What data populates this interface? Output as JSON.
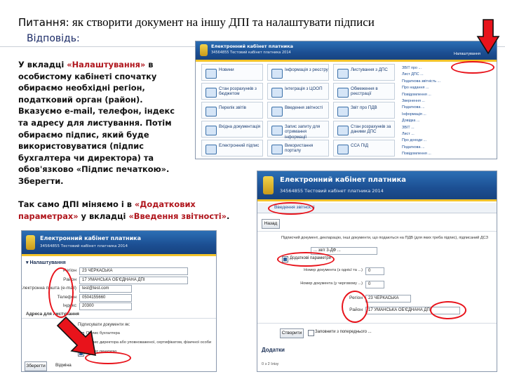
{
  "header": {
    "question_label": "Питання:",
    "question_text": " як створити документ на іншу ДПІ та налаштувати підписи",
    "answer_label": "Відповідь:"
  },
  "instructions": {
    "p1_before": "У вкладці ",
    "p1_quote": "«Налаштування»",
    "p1_after": " в особистому кабінеті спочатку обираємо необхідні регіон, податковий орган (район). Вказуємо e-mail, телефон, індекс та адресу для листування. Потім обираємо підпис, який буде використовуватися (підпис бухгалтера чи директора) та обов'язково «Підпис печаткою». Зберегти.",
    "p2_before": "Так само ДПІ міняємо і в ",
    "p2_quote1": "«Додаткових параметрах»",
    "p2_mid": " у вкладці ",
    "p2_quote2": "«Введення звітності»",
    "p2_after": "."
  },
  "shot_cabinet": {
    "banner_title": "Електронний кабінет платника",
    "banner_sub": "34564855 Тестовий кабінет платника 2014",
    "menu_button": "Налаштування",
    "tiles": [
      {
        "label": "Новини"
      },
      {
        "label": "Інформація з реєстру"
      },
      {
        "label": "Листування з ДПС"
      },
      {
        "label": "Стан розрахунків з бюджетом"
      },
      {
        "label": "Інтеграція з ЦООП"
      },
      {
        "label": "Обмеження в реєстрації"
      },
      {
        "label": "Перелік звітів"
      },
      {
        "label": "Введення звітності"
      },
      {
        "label": "Звіт про ПДВ"
      },
      {
        "label": "Вхідна документація"
      },
      {
        "label": "Запис запиту для отримання інформації"
      },
      {
        "label": "Стан розрахунків за даними ДПС"
      },
      {
        "label": "Електронний підпис"
      },
      {
        "label": "Використання порталу"
      },
      {
        "label": "ССА ПІД"
      }
    ],
    "links": [
      "ЗВІТ про ...",
      "Лист ДПС ...",
      "Податкова звітність ...",
      "Про надання ...",
      "Повідомлення ...",
      "Звернення ...",
      "Податкова ...",
      "Інформація ...",
      "Довідка ...",
      "ЗВІТ ...",
      "Лист ...",
      "Про доходи ...",
      "Податкова ...",
      "Повідомлення ..."
    ]
  },
  "shot_settings": {
    "banner_title": "Електронний кабінет платника",
    "banner_sub": "34564855 Тестовий кабінет платника 2014",
    "section_title": "Налаштування",
    "rows": [
      {
        "label": "Регіон",
        "value": "23 ЧЕРКАСЬКА"
      },
      {
        "label": "Район",
        "value": "17 УМАНСЬКА ОБ'ЄДНАНА ДПІ"
      },
      {
        "label": "Електронна пошта (e-mail)",
        "value": "test@test.com"
      },
      {
        "label": "Телефон",
        "value": "0504155660"
      },
      {
        "label": "Індекс",
        "value": "20300"
      }
    ],
    "address_heading": "Адреса для листування",
    "sign_heading": "Підписувати документи як:",
    "checks": [
      {
        "label": "Підпис бухгалтера",
        "checked": false
      },
      {
        "label": "Підпис директора або уповноваженої, сертифікатом, фізичної особи",
        "checked": true
      },
      {
        "label": "Підпис печаткою",
        "checked": true
      }
    ],
    "save_button": "Зберегти",
    "cancel_button": "Відміна"
  },
  "shot_reporting": {
    "banner_title": "Електронний кабінет платника",
    "banner_sub": "34564855 Тестовий кабінет платника 2014",
    "tab": "Введення звітності",
    "back": "Назад",
    "top_text": "Підписчий документ, декларацію, інші документи, що подаються на ПДВ (для яких треба підпис), підписаний ДСЗ",
    "period_row": "... звіт 3-ДФ ...",
    "extra_params": "Додаткові параметри",
    "rows": [
      {
        "label": "Номер документа (з однієї та ...)",
        "value": "0"
      },
      {
        "label": "Номер документа (у черговому ...)",
        "value": "0"
      }
    ],
    "dpi_rows": [
      {
        "label": "Регіон",
        "value": "23 ЧЕРКАСЬКА"
      },
      {
        "label": "Район",
        "value": "17 УМАНСЬКА ОБ'ЄДНАНА ДПІ"
      }
    ],
    "create_button": "Створити",
    "template_label": "Заповнити з попереднього ...",
    "additions": "Додатки",
    "footer": "0 з 2 Ілізу"
  },
  "colors": {
    "red": "#e8131b",
    "banner": "#1c4f93",
    "quote": "#b0161d"
  }
}
